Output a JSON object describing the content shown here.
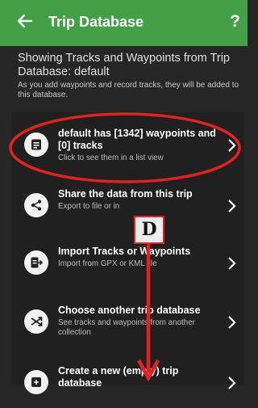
{
  "appbar": {
    "title": "Trip Database",
    "back_icon": "back-arrow-icon",
    "help_label": "?"
  },
  "info": {
    "main": "Showing Tracks and Waypoints from Trip Database: default",
    "sub": "As you add waypoints and record tracks, they will be added to this database."
  },
  "items": [
    {
      "title": "default has [1342] waypoints and [0] tracks",
      "subtitle": "Click to see them in a list view",
      "icon": "list-icon"
    },
    {
      "title": "Share the data from this trip",
      "subtitle": "Export to file or in",
      "icon": "share-icon"
    },
    {
      "title": "Import Tracks or Waypoints",
      "subtitle": "Import from GPX or KML file",
      "icon": "import-icon"
    },
    {
      "title": "Choose another trip database",
      "subtitle": "See tracks and waypoints from another collection",
      "icon": "shuffle-icon"
    },
    {
      "title": "Create a new (empty) trip database",
      "subtitle": "",
      "icon": "add-icon"
    }
  ],
  "annotation": {
    "label": "D",
    "color": "#e62020"
  }
}
